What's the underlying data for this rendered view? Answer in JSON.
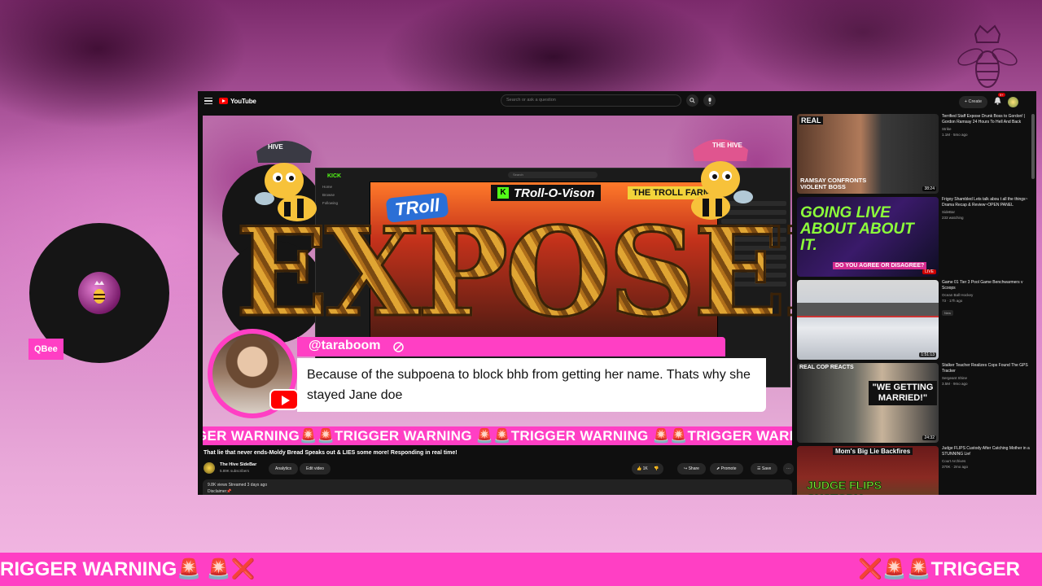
{
  "overlay": {
    "streamer_name": "QBee",
    "ticker_left": "RIGGER WARNING🚨  🚨❌",
    "ticker_right": "❌🚨🚨TRIGGER",
    "crest_icon": "crown-bee-icon"
  },
  "youtube": {
    "logo_text": "YouTube",
    "search_placeholder": "Search or ask a question",
    "create_label": "+ Create",
    "notification_count": "9+",
    "video": {
      "exposed_text": "EXPOSED",
      "hat_left": "HIVE",
      "hat_right": "THE HIVE",
      "inner_app": {
        "logo": "KICK",
        "search": "Search",
        "sidebar": [
          "Home",
          "Browse",
          "Following"
        ],
        "stream_title": "TRoll-O-Vison",
        "stream_badge": "K",
        "right_banner": "THE TROLL FARM",
        "channel_logo": "TRoll"
      },
      "chat": {
        "username": "@taraboom",
        "message": "Because of the subpoena to block bhb from getting her name. Thats why she stayed Jane doe"
      },
      "marquee": "GER WARNING🚨🚨TRIGGER WARNING 🚨🚨TRIGGER WARNING 🚨🚨TRIGGER WARNING 🚨🚨"
    },
    "title": "That lie that never ends-Moldy Bread Speaks out & LIES some more! Responding in real time!",
    "channel": {
      "name": "The Hive SideBar",
      "subs": "5.89K subscribers",
      "analytics": "Analytics",
      "edit": "Edit video"
    },
    "actions": {
      "likes": "1K",
      "share": "Share",
      "promote": "Promote",
      "save": "Save"
    },
    "description": {
      "stats": "9.8K views  Streamed 3 days ago",
      "line": "Disclaimer📌"
    },
    "recommendations": [
      {
        "title": "Terrified Staff Expose Drunk Boss to Gordon! | Gordon Ramsay 24 Hours To Hell And Back",
        "channel": "Strike",
        "stats": "1.1M · 5mo ago",
        "duration": "38:24",
        "thumb_text": "RAMSAY CONFRONTS VIOLENT BOSS",
        "thumb_tag": "REAL"
      },
      {
        "title": "Frigoy Shambled Lets talk abou t all the things~ Drama Recap & Review~OPEN PANEL",
        "channel": "SideBar",
        "stats": "233 watching",
        "duration": "LIVE",
        "thumb_text": "GOING LIVE ABOUT ABOUT IT.",
        "thumb_sub": "DO YOU AGREE OR DISAGREE?"
      },
      {
        "title": "Game 01  Tier 3 Pool Game Benchwarmers v Scoops",
        "channel": "Ocean Ball Hockey",
        "stats": "73 · 17h ago",
        "duration": "1:51:13",
        "tag": "New"
      },
      {
        "title": "Stalker Teacher Realizes Cops Found The GPS Tracker",
        "channel": "Sergeant Shine",
        "stats": "3.5M · 9mo ago",
        "duration": "24:32",
        "thumb_text": "\"WE GETTING MARRIED!\"",
        "thumb_tag": "REAL COP REACTS"
      },
      {
        "title": "Judge FLIPS Custody After Catching Mother in a STUNNING Lie!",
        "channel": "Court Archives",
        "stats": "370K · 2mo ago",
        "duration": "",
        "thumb_text": "JUDGE FLIPS CUSTODY",
        "thumb_sub": "Mom's Big Lie Backfires"
      }
    ]
  },
  "colors": {
    "accent_pink": "#ff3fc4",
    "yt_red": "#ff0000",
    "kick_green": "#53fc18"
  }
}
